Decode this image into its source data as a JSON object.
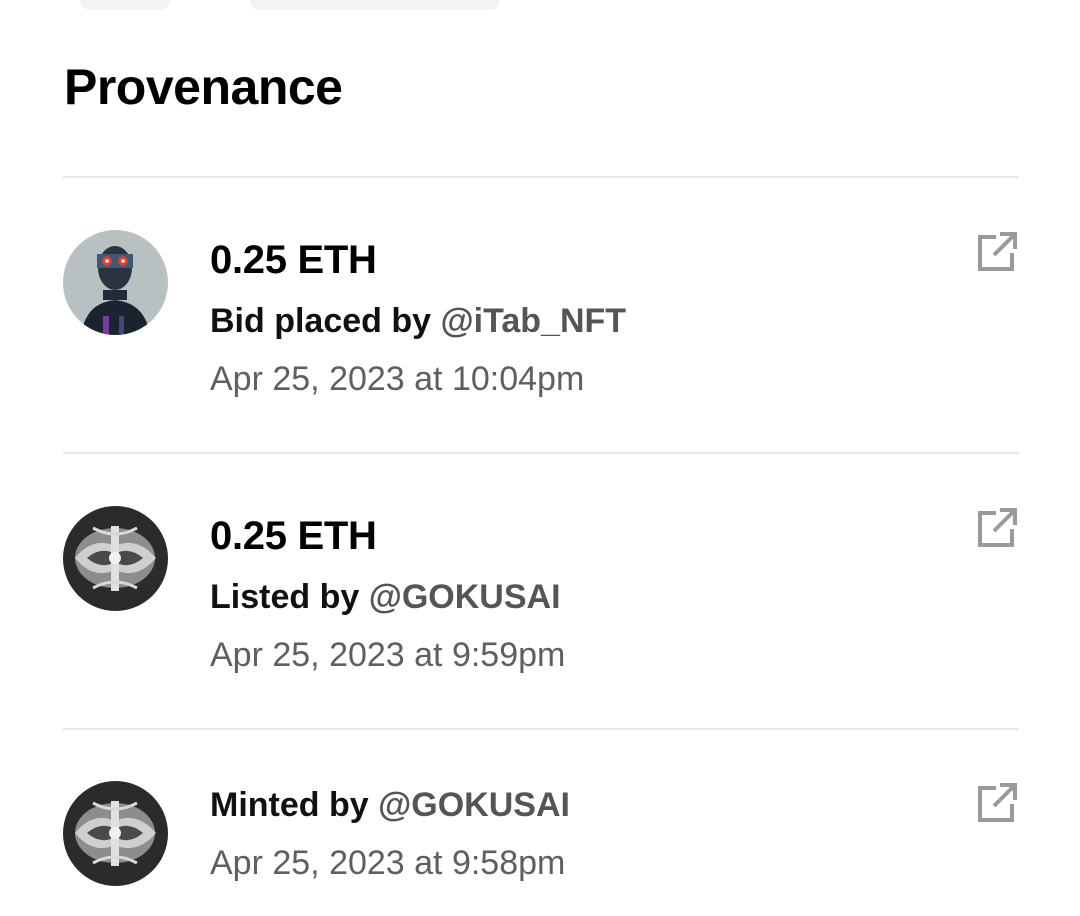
{
  "header": {
    "title": "Provenance"
  },
  "entries": [
    {
      "amount": "0.25 ETH",
      "action_label": "Bid placed by",
      "user": "@iTab_NFT",
      "date": "Apr 25, 2023 at 10:04pm",
      "avatar": "robot-avatar"
    },
    {
      "amount": "0.25 ETH",
      "action_label": "Listed by",
      "user": "@GOKUSAI",
      "date": "Apr 25, 2023 at 9:59pm",
      "avatar": "gokusai-avatar"
    },
    {
      "amount": "",
      "action_label": "Minted by",
      "user": "@GOKUSAI",
      "date": "Apr 25, 2023 at 9:58pm",
      "avatar": "gokusai-avatar"
    }
  ],
  "icons": {
    "external_link": "external-link-icon"
  },
  "colors": {
    "text_primary": "#000000",
    "text_secondary": "#5f5f5f",
    "username": "#555555",
    "divider": "#e6e6e6",
    "icon": "#9a9a9a"
  }
}
